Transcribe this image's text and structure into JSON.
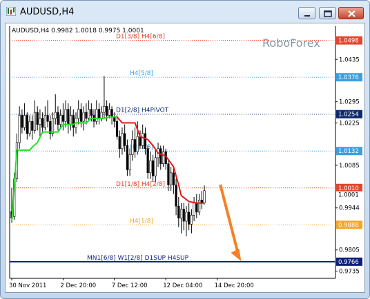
{
  "window": {
    "title": "AUDUSD,H4",
    "controls": {
      "minimize": "minimize",
      "maximize": "maximize",
      "close": "close"
    }
  },
  "chart_data": {
    "type": "candlestick",
    "symbol_info": "AUDUSD,H4  0.9982 1.0018 0.9975 1.0001",
    "watermark": "RoboForex",
    "y_range": [
      0.9711,
      1.0545
    ],
    "y_ticks": [
      {
        "label": "1.0435",
        "value": 1.0435
      },
      {
        "label": "1.0295",
        "value": 1.0295
      },
      {
        "label": "1.0225",
        "value": 1.0225
      },
      {
        "label": "1.0085",
        "value": 1.0085
      },
      {
        "label": "0.9944",
        "value": 0.9944
      },
      {
        "label": "0.9805",
        "value": 0.9805
      },
      {
        "label": "0.9735",
        "value": 0.9735
      }
    ],
    "x_ticks": [
      {
        "label": "30 Nov 2011",
        "index": 0
      },
      {
        "label": "2 Dec 20:00",
        "index": 20
      },
      {
        "label": "7 Dec 12:00",
        "index": 40
      },
      {
        "label": "12 Dec 04:00",
        "index": 60
      },
      {
        "label": "14 Dec 20:00",
        "index": 80
      }
    ],
    "levels": [
      {
        "name": "D1[3/8] H4[6/8]",
        "value": 1.0498,
        "price_label": "1.0498",
        "color": "#e8442c",
        "style": "dotted"
      },
      {
        "name": "H4[5/8]",
        "value": 1.0376,
        "price_label": "1.0376",
        "color": "#3ba0de",
        "style": "dotted"
      },
      {
        "name": "D1[2/8] H4PIVOT",
        "value": 1.0254,
        "price_label": "1.0254",
        "color": "#0d2a6e",
        "style": "dotted"
      },
      {
        "name": "H4[3/8]",
        "value": 1.0132,
        "price_label": "1.0132",
        "color": "#3ba0de",
        "style": "dotted"
      },
      {
        "name": "D1[1/8] H4[2/8]",
        "value": 1.001,
        "price_label": "1.0010",
        "color": "#e8442c",
        "style": "dotted"
      },
      {
        "name": "H4[1/8]",
        "value": 0.9888,
        "price_label": "0.9888",
        "color": "#f5a623",
        "style": "dotted"
      },
      {
        "name": "MN1[6/8] W1[2/8] D1SUP H4SUP",
        "value": 0.9766,
        "price_label": "0.9766",
        "color": "#0d1f7a",
        "style": "solid"
      }
    ],
    "current_price_label": "1.0001",
    "current_price": 1.0001,
    "trend_line": {
      "green": [
        [
          0,
          0.99
        ],
        [
          2,
          1.0135
        ],
        [
          7,
          1.0135
        ],
        [
          8,
          1.0145
        ],
        [
          10,
          1.016
        ],
        [
          12,
          1.0195
        ],
        [
          18,
          1.0195
        ],
        [
          20,
          1.022
        ],
        [
          24,
          1.022
        ],
        [
          25,
          1.0225
        ],
        [
          29,
          1.0225
        ],
        [
          31,
          1.024
        ],
        [
          36,
          1.024
        ],
        [
          38,
          1.0245
        ],
        [
          41,
          1.0245
        ]
      ],
      "red": [
        [
          41,
          1.0245
        ],
        [
          43,
          1.0225
        ],
        [
          48,
          1.0225
        ],
        [
          50,
          1.018
        ],
        [
          53,
          1.017
        ],
        [
          55,
          1.015
        ],
        [
          57,
          1.0125
        ],
        [
          60,
          1.0115
        ],
        [
          63,
          1.008
        ],
        [
          65,
          1.002
        ],
        [
          66,
          0.9985
        ],
        [
          69,
          0.9965
        ],
        [
          72,
          0.996
        ],
        [
          75,
          0.996
        ]
      ]
    },
    "candles": [
      [
        0.9932,
        0.991,
        1.001,
        0.9895
      ],
      [
        0.9915,
        1.004,
        1.006,
        0.9905
      ],
      [
        1.004,
        1.016,
        1.019,
        1.003
      ],
      [
        1.016,
        1.025,
        1.028,
        1.014
      ],
      [
        1.025,
        1.021,
        1.027,
        1.019
      ],
      [
        1.021,
        1.025,
        1.029,
        1.02
      ],
      [
        1.025,
        1.019,
        1.026,
        1.017
      ],
      [
        1.019,
        1.023,
        1.025,
        1.018
      ],
      [
        1.023,
        1.02,
        1.025,
        1.017
      ],
      [
        1.02,
        1.026,
        1.03,
        1.019
      ],
      [
        1.026,
        1.022,
        1.028,
        1.02
      ],
      [
        1.022,
        1.024,
        1.027,
        1.018
      ],
      [
        1.024,
        1.021,
        1.026,
        1.019
      ],
      [
        1.021,
        1.025,
        1.028,
        1.02
      ],
      [
        1.025,
        1.023,
        1.03,
        1.021
      ],
      [
        1.023,
        1.019,
        1.025,
        1.017
      ],
      [
        1.019,
        1.024,
        1.026,
        1.018
      ],
      [
        1.024,
        1.026,
        1.032,
        1.022
      ],
      [
        1.026,
        1.022,
        1.028,
        1.02
      ],
      [
        1.022,
        1.025,
        1.027,
        1.021
      ],
      [
        1.025,
        1.023,
        1.029,
        1.02
      ],
      [
        1.023,
        1.027,
        1.03,
        1.021
      ],
      [
        1.027,
        1.022,
        1.029,
        1.019
      ],
      [
        1.022,
        1.025,
        1.028,
        1.02
      ],
      [
        1.025,
        1.021,
        1.027,
        1.018
      ],
      [
        1.021,
        1.024,
        1.026,
        1.019
      ],
      [
        1.024,
        1.027,
        1.03,
        1.022
      ],
      [
        1.027,
        1.023,
        1.029,
        1.021
      ],
      [
        1.023,
        1.026,
        1.028,
        1.02
      ],
      [
        1.026,
        1.024,
        1.029,
        1.022
      ],
      [
        1.024,
        1.027,
        1.03,
        1.023
      ],
      [
        1.027,
        1.025,
        1.029,
        1.023
      ],
      [
        1.025,
        1.023,
        1.027,
        1.021
      ],
      [
        1.023,
        1.027,
        1.03,
        1.022
      ],
      [
        1.027,
        1.024,
        1.029,
        1.022
      ],
      [
        1.024,
        1.026,
        1.028,
        1.023
      ],
      [
        1.026,
        1.028,
        1.038,
        1.024
      ],
      [
        1.028,
        1.025,
        1.03,
        1.023
      ],
      [
        1.025,
        1.027,
        1.029,
        1.024
      ],
      [
        1.027,
        1.0245,
        1.028,
        1.022
      ],
      [
        1.0245,
        1.023,
        1.026,
        1.021
      ],
      [
        1.023,
        1.018,
        1.025,
        1.017
      ],
      [
        1.018,
        1.014,
        1.02,
        1.011
      ],
      [
        1.014,
        1.019,
        1.021,
        1.012
      ],
      [
        1.019,
        1.015,
        1.022,
        1.013
      ],
      [
        1.015,
        1.007,
        1.017,
        1.005
      ],
      [
        1.007,
        1.012,
        1.014,
        1.005
      ],
      [
        1.012,
        1.017,
        1.02,
        1.01
      ],
      [
        1.017,
        1.013,
        1.021,
        1.011
      ],
      [
        1.013,
        1.018,
        1.023,
        1.012
      ],
      [
        1.018,
        1.015,
        1.02,
        1.014
      ],
      [
        1.015,
        1.019,
        1.022,
        1.014
      ],
      [
        1.019,
        1.014,
        1.021,
        1.012
      ],
      [
        1.014,
        1.006,
        1.015,
        1.004
      ],
      [
        1.006,
        1.01,
        1.013,
        1.004
      ],
      [
        1.01,
        1.005,
        1.012,
        1.003
      ],
      [
        1.005,
        1.011,
        1.014,
        1.003
      ],
      [
        1.011,
        1.014,
        1.016,
        1.008
      ],
      [
        1.014,
        1.009,
        1.015,
        1.007
      ],
      [
        1.009,
        1.013,
        1.015,
        1.008
      ],
      [
        1.013,
        1.009,
        1.014,
        1.007
      ],
      [
        1.009,
        1.002,
        1.01,
        1.0
      ],
      [
        1.002,
        1.006,
        1.008,
        1.0
      ],
      [
        1.006,
        1.002,
        1.008,
        0.999
      ],
      [
        1.002,
        0.995,
        1.004,
        0.992
      ],
      [
        0.995,
        0.991,
        0.998,
        0.988
      ],
      [
        0.991,
        0.994,
        0.996,
        0.986
      ],
      [
        0.994,
        0.99,
        0.996,
        0.987
      ],
      [
        0.99,
        0.993,
        0.995,
        0.985
      ],
      [
        0.993,
        0.989,
        0.996,
        0.987
      ],
      [
        0.989,
        0.992,
        0.994,
        0.986
      ],
      [
        0.992,
        0.996,
        0.998,
        0.99
      ],
      [
        0.996,
        0.993,
        0.999,
        0.991
      ],
      [
        0.993,
        0.997,
        0.999,
        0.992
      ],
      [
        0.997,
        0.996,
        1.0,
        0.994
      ],
      [
        0.996,
        1.0001,
        1.0018,
        0.9955
      ]
    ],
    "arrow": {
      "from": [
        78,
        0.998
      ],
      "to": [
        88,
        0.975
      ],
      "color": "#f58025"
    }
  }
}
